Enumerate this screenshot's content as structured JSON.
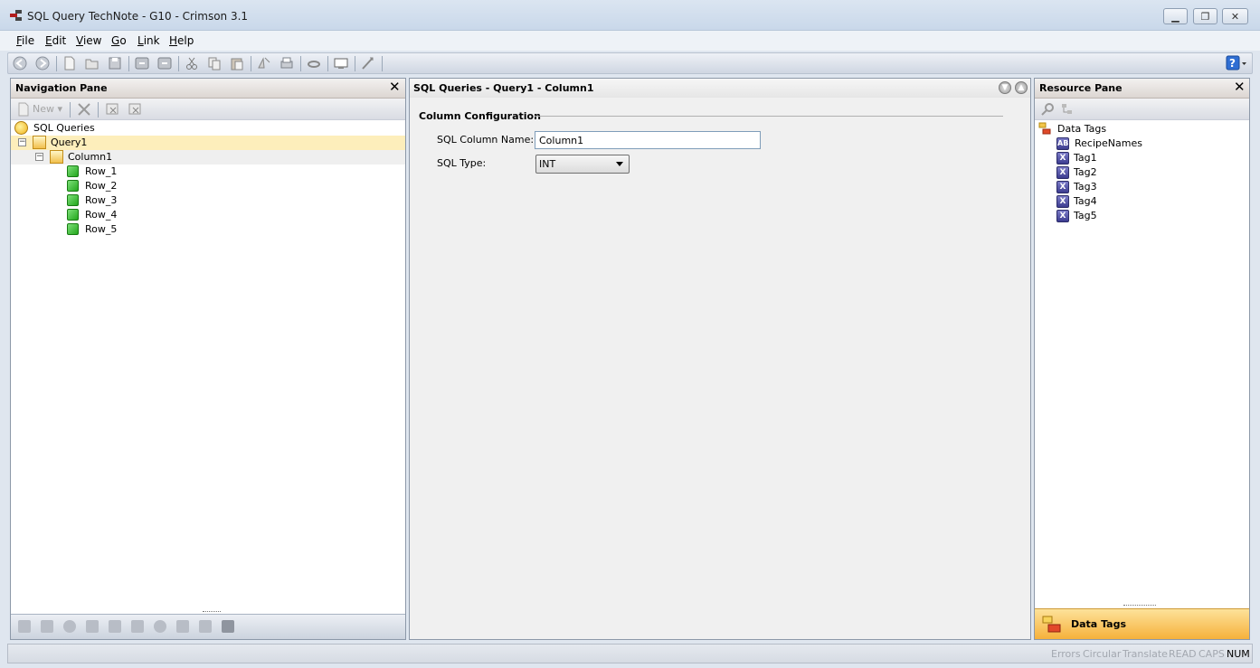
{
  "window": {
    "title": "SQL Query TechNote - G10 - Crimson 3.1"
  },
  "menu": {
    "items": [
      {
        "label": "File",
        "key": "F",
        "rest": "ile"
      },
      {
        "label": "Edit",
        "key": "E",
        "rest": "dit"
      },
      {
        "label": "View",
        "key": "V",
        "rest": "iew"
      },
      {
        "label": "Go",
        "key": "G",
        "rest": "o"
      },
      {
        "label": "Link",
        "key": "L",
        "rest": "ink"
      },
      {
        "label": "Help",
        "key": "H",
        "rest": "elp"
      }
    ]
  },
  "nav_pane": {
    "title": "Navigation Pane",
    "new_label": "New",
    "tree": [
      {
        "label": "SQL Queries",
        "icon": "sql-queries-icon"
      },
      {
        "label": "Query1",
        "icon": "query-icon",
        "expander": "−"
      },
      {
        "label": "Column1",
        "icon": "column-icon",
        "expander": "−"
      },
      {
        "label": "Row_1",
        "icon": "row-cube-icon"
      },
      {
        "label": "Row_2",
        "icon": "row-cube-icon"
      },
      {
        "label": "Row_3",
        "icon": "row-cube-icon"
      },
      {
        "label": "Row_4",
        "icon": "row-cube-icon"
      },
      {
        "label": "Row_5",
        "icon": "row-cube-icon"
      }
    ]
  },
  "main": {
    "breadcrumb": "SQL Queries - Query1 - Column1",
    "group_title": "Column Configuration",
    "column_name_label": "SQL Column Name:",
    "column_name_value": "Column1",
    "sql_type_label": "SQL Type:",
    "sql_type_value": "INT"
  },
  "resource_pane": {
    "title": "Resource Pane",
    "root": "Data Tags",
    "items": [
      {
        "label": "RecipeNames",
        "icon": "string-tag-icon",
        "glyph": "AB"
      },
      {
        "label": "Tag1",
        "icon": "tag-icon",
        "glyph": "X"
      },
      {
        "label": "Tag2",
        "icon": "tag-icon",
        "glyph": "X"
      },
      {
        "label": "Tag3",
        "icon": "tag-icon",
        "glyph": "X"
      },
      {
        "label": "Tag4",
        "icon": "tag-icon",
        "glyph": "X"
      },
      {
        "label": "Tag5",
        "icon": "tag-icon",
        "glyph": "X"
      }
    ],
    "tab_label": "Data Tags"
  },
  "status": {
    "items": [
      {
        "label": "Errors",
        "active": false
      },
      {
        "label": "Circular",
        "active": false
      },
      {
        "label": "Translate",
        "active": false
      },
      {
        "label": "READ",
        "active": false
      },
      {
        "label": "CAPS",
        "active": false
      },
      {
        "label": "NUM",
        "active": true
      }
    ]
  },
  "colors": {
    "selected_row": "#fdeebb",
    "tab_accent": "#f6b13b",
    "pane_border": "#8c98a8"
  }
}
